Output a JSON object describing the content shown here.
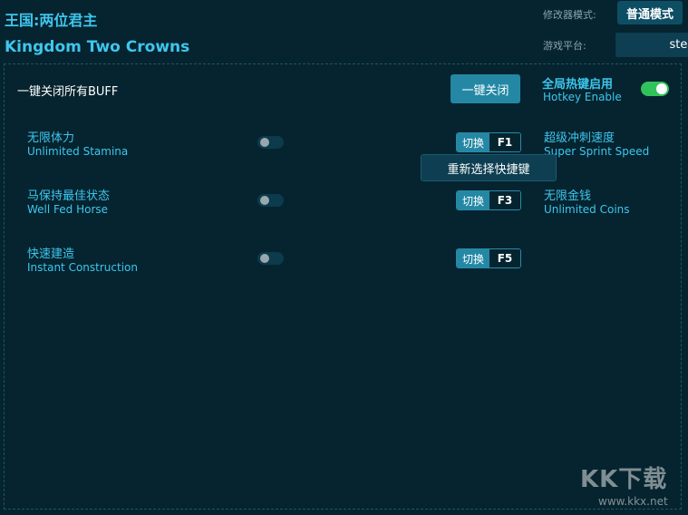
{
  "header": {
    "title_cn": "王国:两位君主",
    "title_en": "Kingdom Two Crowns",
    "mode_label": "修改器模式:",
    "mode_value": "普通模式",
    "platform_label": "游戏平台:",
    "platform_value": "steam"
  },
  "global": {
    "all_off_label": "一键关闭所有BUFF",
    "all_off_button": "一键关闭",
    "hotkey_cn": "全局热键启用",
    "hotkey_en": "Hotkey Enable",
    "hotkey_enabled": true
  },
  "tooltip": "重新选择快捷键",
  "cheats_left": [
    {
      "cn": "无限体力",
      "en": "Unlimited Stamina",
      "toggle_label": "切换",
      "key": "F1",
      "enabled": false
    },
    {
      "cn": "马保持最佳状态",
      "en": "Well Fed Horse",
      "toggle_label": "切换",
      "key": "F3",
      "enabled": false
    },
    {
      "cn": "快速建造",
      "en": "Instant Construction",
      "toggle_label": "切换",
      "key": "F5",
      "enabled": false
    }
  ],
  "cheats_right": [
    {
      "cn": "超级冲刺速度",
      "en": "Super Sprint Speed"
    },
    {
      "cn": "无限金钱",
      "en": "Unlimited Coins"
    }
  ],
  "watermark": {
    "main": "KK下载",
    "sub": "www.kkx.net"
  },
  "colors": {
    "accent": "#3fc6ee",
    "background": "#05242f",
    "button": "#2488a5",
    "switch_on": "#31c35b"
  }
}
